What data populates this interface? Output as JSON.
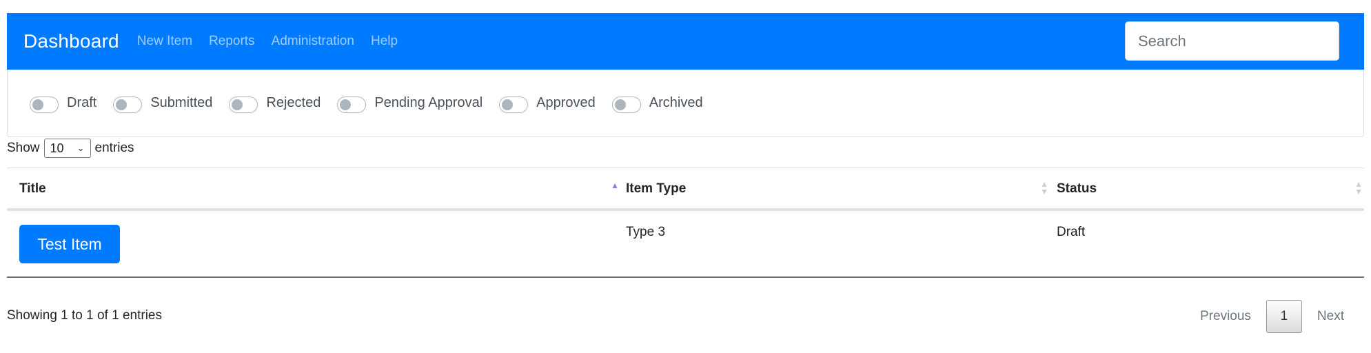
{
  "navbar": {
    "brand": "Dashboard",
    "links": [
      "New Item",
      "Reports",
      "Administration",
      "Help"
    ],
    "search_placeholder": "Search",
    "bg_color": "#007bff"
  },
  "filters": [
    "Draft",
    "Submitted",
    "Rejected",
    "Pending Approval",
    "Approved",
    "Archived"
  ],
  "length": {
    "prefix": "Show",
    "value": "10",
    "suffix": "entries"
  },
  "table": {
    "headers": [
      "Title",
      "Item Type",
      "Status"
    ],
    "sorted_column": "Title",
    "sort_direction": "ascending",
    "rows": [
      {
        "title": "Test Item",
        "item_type": "Type 3",
        "status": "Draft"
      }
    ]
  },
  "footer": {
    "info": "Showing 1 to 1 of 1 entries",
    "previous": "Previous",
    "current_page": "1",
    "next": "Next"
  }
}
